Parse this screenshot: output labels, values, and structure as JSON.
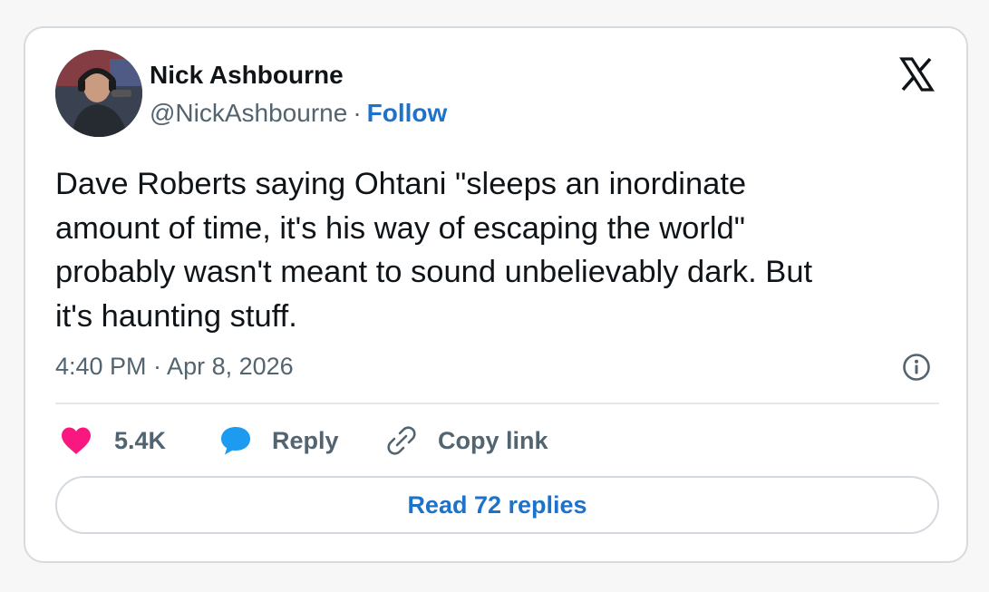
{
  "author": {
    "display_name": "Nick Ashbourne",
    "handle": "@NickAshbourne",
    "separator": "·",
    "follow_label": "Follow",
    "avatar_icon": "avatar-photo"
  },
  "platform": {
    "logo_icon": "x-logo-icon"
  },
  "tweet": {
    "lines": [
      "Dave Roberts saying Ohtani \"sleeps an inordinate",
      "amount of time, it's his way of escaping the world\"",
      "probably wasn't meant to sound unbelievably dark. But",
      "it's haunting stuff."
    ],
    "timestamp": "4:40 PM · Apr 8, 2026"
  },
  "actions": {
    "like": {
      "icon": "heart-icon",
      "label": "5.4K"
    },
    "reply": {
      "icon": "speech-bubble-icon",
      "label": "Reply"
    },
    "copy": {
      "icon": "link-icon",
      "label": "Copy link"
    },
    "info_icon": "info-icon"
  },
  "read_replies": {
    "label": "Read 72 replies"
  },
  "colors": {
    "link_blue": "#1d73c9",
    "heart_pink": "#f91880",
    "reply_blue": "#1d9bf0",
    "text_primary": "#0f1419",
    "text_secondary": "#536471",
    "border": "#d6dbe0"
  }
}
